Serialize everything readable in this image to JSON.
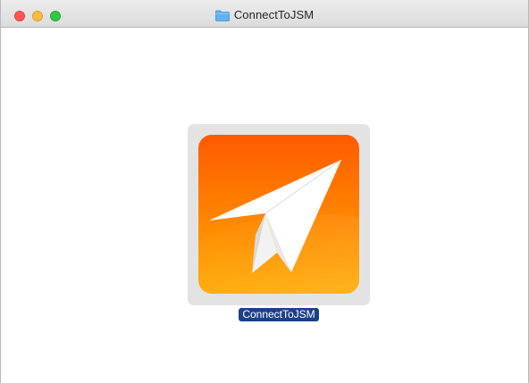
{
  "window": {
    "title": "ConnectToJSM",
    "title_icon": "folder-icon",
    "buttons": [
      "close",
      "minimize",
      "zoom"
    ]
  },
  "content": {
    "items": [
      {
        "label": "ConnectToJSM",
        "icon": "paper-plane-app-icon",
        "selected": true
      }
    ]
  },
  "colors": {
    "close": "#fc5753",
    "minimize": "#fdbc40",
    "zoom": "#33c748",
    "icon_top": "#ff5a00",
    "icon_bottom": "#ffa800",
    "selection_label_bg": "#1b4189",
    "selection_icon_bg": "#e3e3e3"
  }
}
